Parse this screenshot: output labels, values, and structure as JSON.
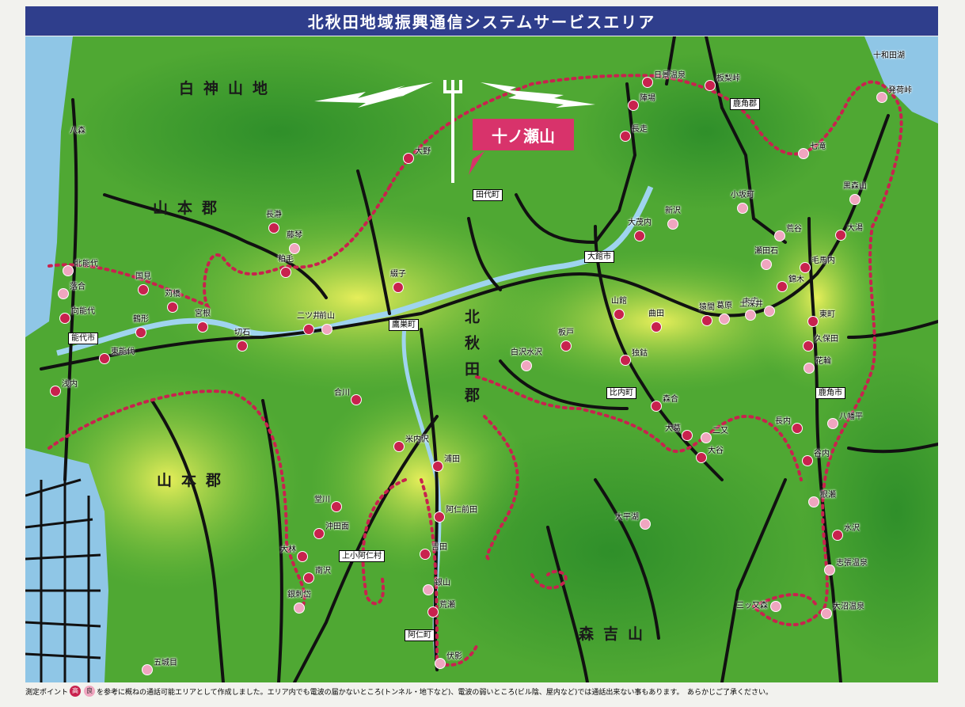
{
  "title": "北秋田地域振興通信システムサービスエリア",
  "transmitter": {
    "name": "十ノ瀬山"
  },
  "colors": {
    "high": "#c8224e",
    "good": "#f0a6c0",
    "route": "#c8224e",
    "title_bg": "#2f3e8c"
  },
  "regions": [
    {
      "id": "shirakami",
      "text": "白神山地"
    },
    {
      "id": "yamamoto1",
      "text": "山本郡"
    },
    {
      "id": "yamamoto2",
      "text": "山本郡"
    },
    {
      "id": "kitaakita",
      "text": "北秋田郡"
    },
    {
      "id": "moriyoshi",
      "text": "森吉山"
    }
  ],
  "boxed_places": [
    {
      "id": "tashiro",
      "text": "田代町"
    },
    {
      "id": "odate",
      "text": "大館市"
    },
    {
      "id": "noshiro",
      "text": "能代市"
    },
    {
      "id": "takanosu",
      "text": "鷹巣町"
    },
    {
      "id": "hinai",
      "text": "比内町"
    },
    {
      "id": "kazuno_gun",
      "text": "鹿角郡"
    },
    {
      "id": "kazuno_shi",
      "text": "鹿角市"
    },
    {
      "id": "kamikoani",
      "text": "上小阿仁村"
    },
    {
      "id": "ani",
      "text": "阿仁町"
    }
  ],
  "plain_places": [
    {
      "id": "hachimori",
      "text": "八森"
    },
    {
      "id": "towadako",
      "text": "十和田湖"
    },
    {
      "id": "gojome",
      "text": "五城目"
    }
  ],
  "points": [
    {
      "name": "大野",
      "level": "high"
    },
    {
      "name": "日景温泉",
      "level": "high"
    },
    {
      "name": "陣場",
      "level": "high"
    },
    {
      "name": "長走",
      "level": "high"
    },
    {
      "name": "板梨峠",
      "level": "high"
    },
    {
      "name": "発荷峠",
      "level": "good"
    },
    {
      "name": "七滝",
      "level": "good"
    },
    {
      "name": "小坂町",
      "level": "good"
    },
    {
      "name": "黒森山",
      "level": "good"
    },
    {
      "name": "大湯",
      "level": "high"
    },
    {
      "name": "荒谷",
      "level": "good"
    },
    {
      "name": "毛馬内",
      "level": "high"
    },
    {
      "name": "錦木",
      "level": "high"
    },
    {
      "name": "瀬田石",
      "level": "good"
    },
    {
      "name": "大茂内",
      "level": "high"
    },
    {
      "name": "新沢",
      "level": "good"
    },
    {
      "name": "長瀞",
      "level": "high"
    },
    {
      "name": "藤琴",
      "level": "good"
    },
    {
      "name": "粕毛",
      "level": "high"
    },
    {
      "name": "北能代",
      "level": "good"
    },
    {
      "name": "国見",
      "level": "high"
    },
    {
      "name": "落合",
      "level": "good"
    },
    {
      "name": "苅橋",
      "level": "high"
    },
    {
      "name": "向能代",
      "level": "high"
    },
    {
      "name": "鶴形",
      "level": "high"
    },
    {
      "name": "宮根",
      "level": "high"
    },
    {
      "name": "二ツ井",
      "level": "high"
    },
    {
      "name": "前山",
      "level": "good"
    },
    {
      "name": "切石",
      "level": "high"
    },
    {
      "name": "東能代",
      "level": "high"
    },
    {
      "name": "浅内",
      "level": "high"
    },
    {
      "name": "綴子",
      "level": "high"
    },
    {
      "name": "山館",
      "level": "high"
    },
    {
      "name": "曲田",
      "level": "high"
    },
    {
      "name": "猿間",
      "level": "high"
    },
    {
      "name": "葛原",
      "level": "good"
    },
    {
      "name": "末広",
      "level": "good"
    },
    {
      "name": "土深井",
      "level": "good"
    },
    {
      "name": "東町",
      "level": "high"
    },
    {
      "name": "久保田",
      "level": "high"
    },
    {
      "name": "花輪",
      "level": "good"
    },
    {
      "name": "板戸",
      "level": "high"
    },
    {
      "name": "白沢水沢",
      "level": "good"
    },
    {
      "name": "独鈷",
      "level": "high"
    },
    {
      "name": "森合",
      "level": "high"
    },
    {
      "name": "大葛",
      "level": "high"
    },
    {
      "name": "二又",
      "level": "good"
    },
    {
      "name": "大谷",
      "level": "high"
    },
    {
      "name": "長内",
      "level": "high"
    },
    {
      "name": "八幡平",
      "level": "good"
    },
    {
      "name": "谷内",
      "level": "high"
    },
    {
      "name": "合川",
      "level": "high"
    },
    {
      "name": "米内沢",
      "level": "high"
    },
    {
      "name": "浦田",
      "level": "high"
    },
    {
      "name": "堂川",
      "level": "high"
    },
    {
      "name": "沖田面",
      "level": "high"
    },
    {
      "name": "大林",
      "level": "high"
    },
    {
      "name": "南沢",
      "level": "high"
    },
    {
      "name": "銀刺岱",
      "level": "good"
    },
    {
      "name": "阿仁前田",
      "level": "high"
    },
    {
      "name": "吉田",
      "level": "high"
    },
    {
      "name": "銀山",
      "level": "good"
    },
    {
      "name": "荒瀬",
      "level": "high"
    },
    {
      "name": "伏影",
      "level": "good"
    },
    {
      "name": "大平湖",
      "level": "good"
    },
    {
      "name": "根瀬",
      "level": "good"
    },
    {
      "name": "水沢",
      "level": "high"
    },
    {
      "name": "志張温泉",
      "level": "good"
    },
    {
      "name": "三ッ又森",
      "level": "good"
    },
    {
      "name": "大沼温泉",
      "level": "good"
    },
    {
      "name": "五城目",
      "level": "good"
    }
  ],
  "footer": {
    "lead": "測定ポイント",
    "legend_high": "高",
    "legend_good": "良",
    "text": "を参考に概ねの通話可能エリアとして作成しました。エリア内でも電波の届かないところ(トンネル・地下など)、電波の弱いところ(ビル陰、屋内など)では通話出来ない事もあります。　あらかじご了承ください。"
  }
}
